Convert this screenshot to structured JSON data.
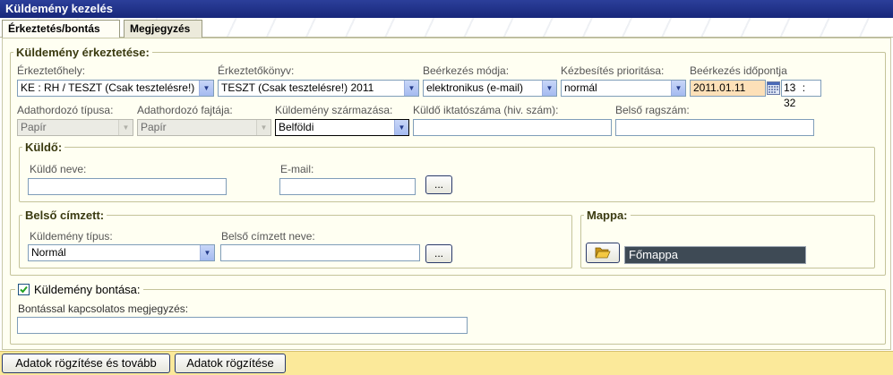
{
  "window": {
    "title": "Küldemény kezelés"
  },
  "tabs": [
    {
      "label": "Érkeztetés/bontás"
    },
    {
      "label": "Megjegyzés"
    }
  ],
  "arrival": {
    "legend": "Küldemény érkeztetése:",
    "location_label": "Érkeztetőhely:",
    "location_value": "KE : RH / TESZT (Csak tesztelésre!)",
    "book_label": "Érkeztetőkönyv:",
    "book_value": "TESZT (Csak tesztelésre!) 2011",
    "method_label": "Beérkezés módja:",
    "method_value": "elektronikus (e-mail)",
    "priority_label": "Kézbesítés prioritása:",
    "priority_value": "normál",
    "time_label": "Beérkezés időpontja",
    "date_value": "2011.01.11",
    "hour_value": "13",
    "minute_value": "32",
    "time_sep": ":",
    "media_type_label": "Adathordozó típusa:",
    "media_type_value": "Papír",
    "media_kind_label": "Adathordozó fajtája:",
    "media_kind_value": "Papír",
    "origin_label": "Küldemény származása:",
    "origin_value": "Belföldi",
    "sender_ref_label": "Küldő iktatószáma (hiv. szám):",
    "sender_ref_value": "",
    "internal_no_label": "Belső ragszám:",
    "internal_no_value": ""
  },
  "sender": {
    "legend": "Küldő:",
    "name_label": "Küldő neve:",
    "name_value": "",
    "email_label": "E-mail:",
    "email_value": "",
    "lookup_label": "..."
  },
  "recipient": {
    "legend": "Belső címzett:",
    "type_label": "Küldemény típus:",
    "type_value": "Normál",
    "name_label": "Belső címzett neve:",
    "name_value": "",
    "lookup_label": "..."
  },
  "folder": {
    "legend": "Mappa:",
    "value": "Főmappa",
    "folder_icon": "folder-open-icon"
  },
  "opening": {
    "checkbox_label": "Küldemény bontása:",
    "checked": true,
    "note_label": "Bontással kapcsolatos megjegyzés:",
    "note_value": ""
  },
  "footer": {
    "save_next_label": "Adatok rögzítése és tovább",
    "save_label": "Adatok rögzítése"
  },
  "colors": {
    "titlebar": "#1f2f88",
    "panel_bg": "#fffff2",
    "footer_bg": "#fbe99a",
    "date_bg": "#fde0b8",
    "folder_field_bg": "#3e4a55"
  }
}
